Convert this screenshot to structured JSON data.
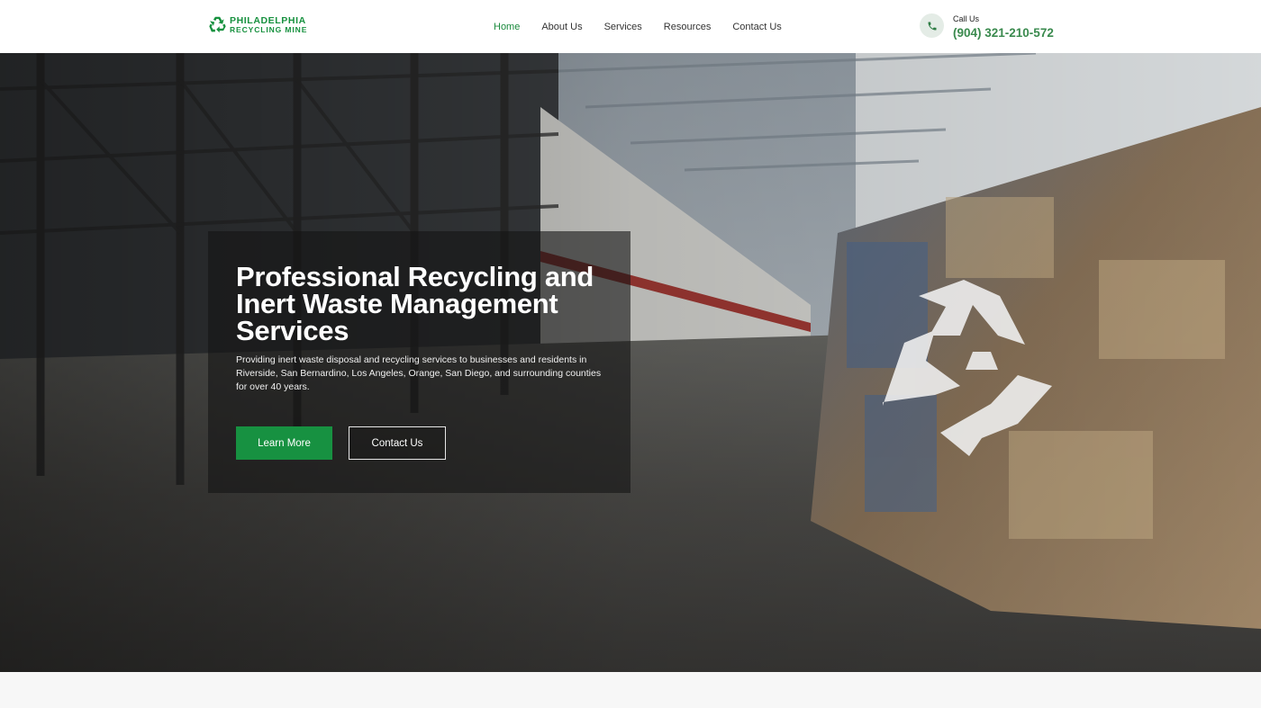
{
  "brand": {
    "logo_line1": "PHILADELPHIA",
    "logo_line2": "RECYCLING MINE",
    "logo_icon": "recycle-icon",
    "accent_color": "#17913f"
  },
  "nav": {
    "items": [
      {
        "label": "Home",
        "active": true
      },
      {
        "label": "About Us",
        "active": false
      },
      {
        "label": "Services",
        "active": false
      },
      {
        "label": "Resources",
        "active": false
      },
      {
        "label": "Contact Us",
        "active": false
      }
    ]
  },
  "call": {
    "icon": "phone-icon",
    "label": "Call Us",
    "number": "(904) 321-210-572"
  },
  "hero": {
    "title": "Professional Recycling and Inert Waste Management Services",
    "description": "Providing inert waste disposal and recycling services to businesses and residents in Riverside, San Bernardino, Los Angeles, Orange, San Diego, and surrounding counties for over 40 years.",
    "primary_button": "Learn More",
    "secondary_button": "Contact Us",
    "background_icon": "recycle-icon"
  }
}
